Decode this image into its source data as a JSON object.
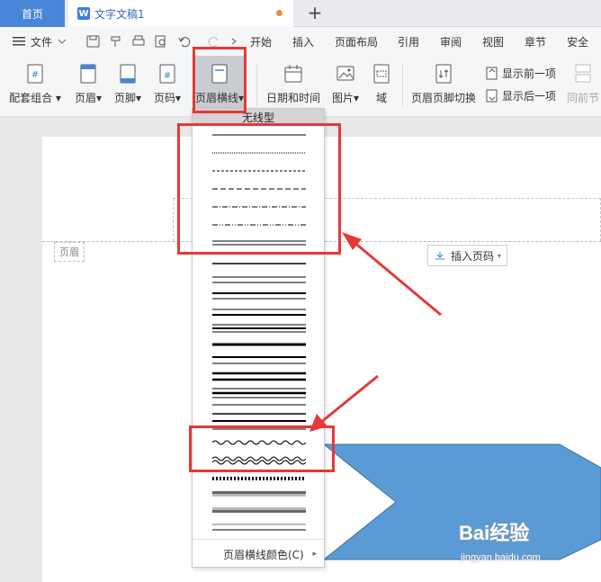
{
  "tabs": {
    "home_label": "首页",
    "doc_icon": "W",
    "doc_label": "文字文稿1",
    "new_tab_symbol": "+"
  },
  "menu": {
    "file_label": "文件",
    "items": [
      "开始",
      "插入",
      "页面布局",
      "引用",
      "审阅",
      "视图",
      "章节",
      "安全"
    ]
  },
  "ribbon": {
    "combo_label": "配套组合",
    "header_label": "页眉",
    "footer_label": "页脚",
    "page_num_label": "页码",
    "header_line_label": "页眉横线",
    "datetime_label": "日期和时间",
    "picture_label": "图片",
    "field_label": "域",
    "switch_label": "页眉页脚切换",
    "show_prev_label": "显示前一项",
    "show_next_label": "显示后一项",
    "same_prev_label": "同前节"
  },
  "document": {
    "header_tag": "页眉",
    "insert_page_num_label": "插入页码"
  },
  "dropdown": {
    "no_line_label": "无线型",
    "color_label": "页眉横线颜色(C)"
  },
  "watermark": {
    "brand": "Bai经验",
    "url": "jingyan.baidu.com"
  },
  "colors": {
    "accent": "#4a86d8",
    "highlight": "#e53935",
    "shape_fill": "#5b9bd5"
  }
}
